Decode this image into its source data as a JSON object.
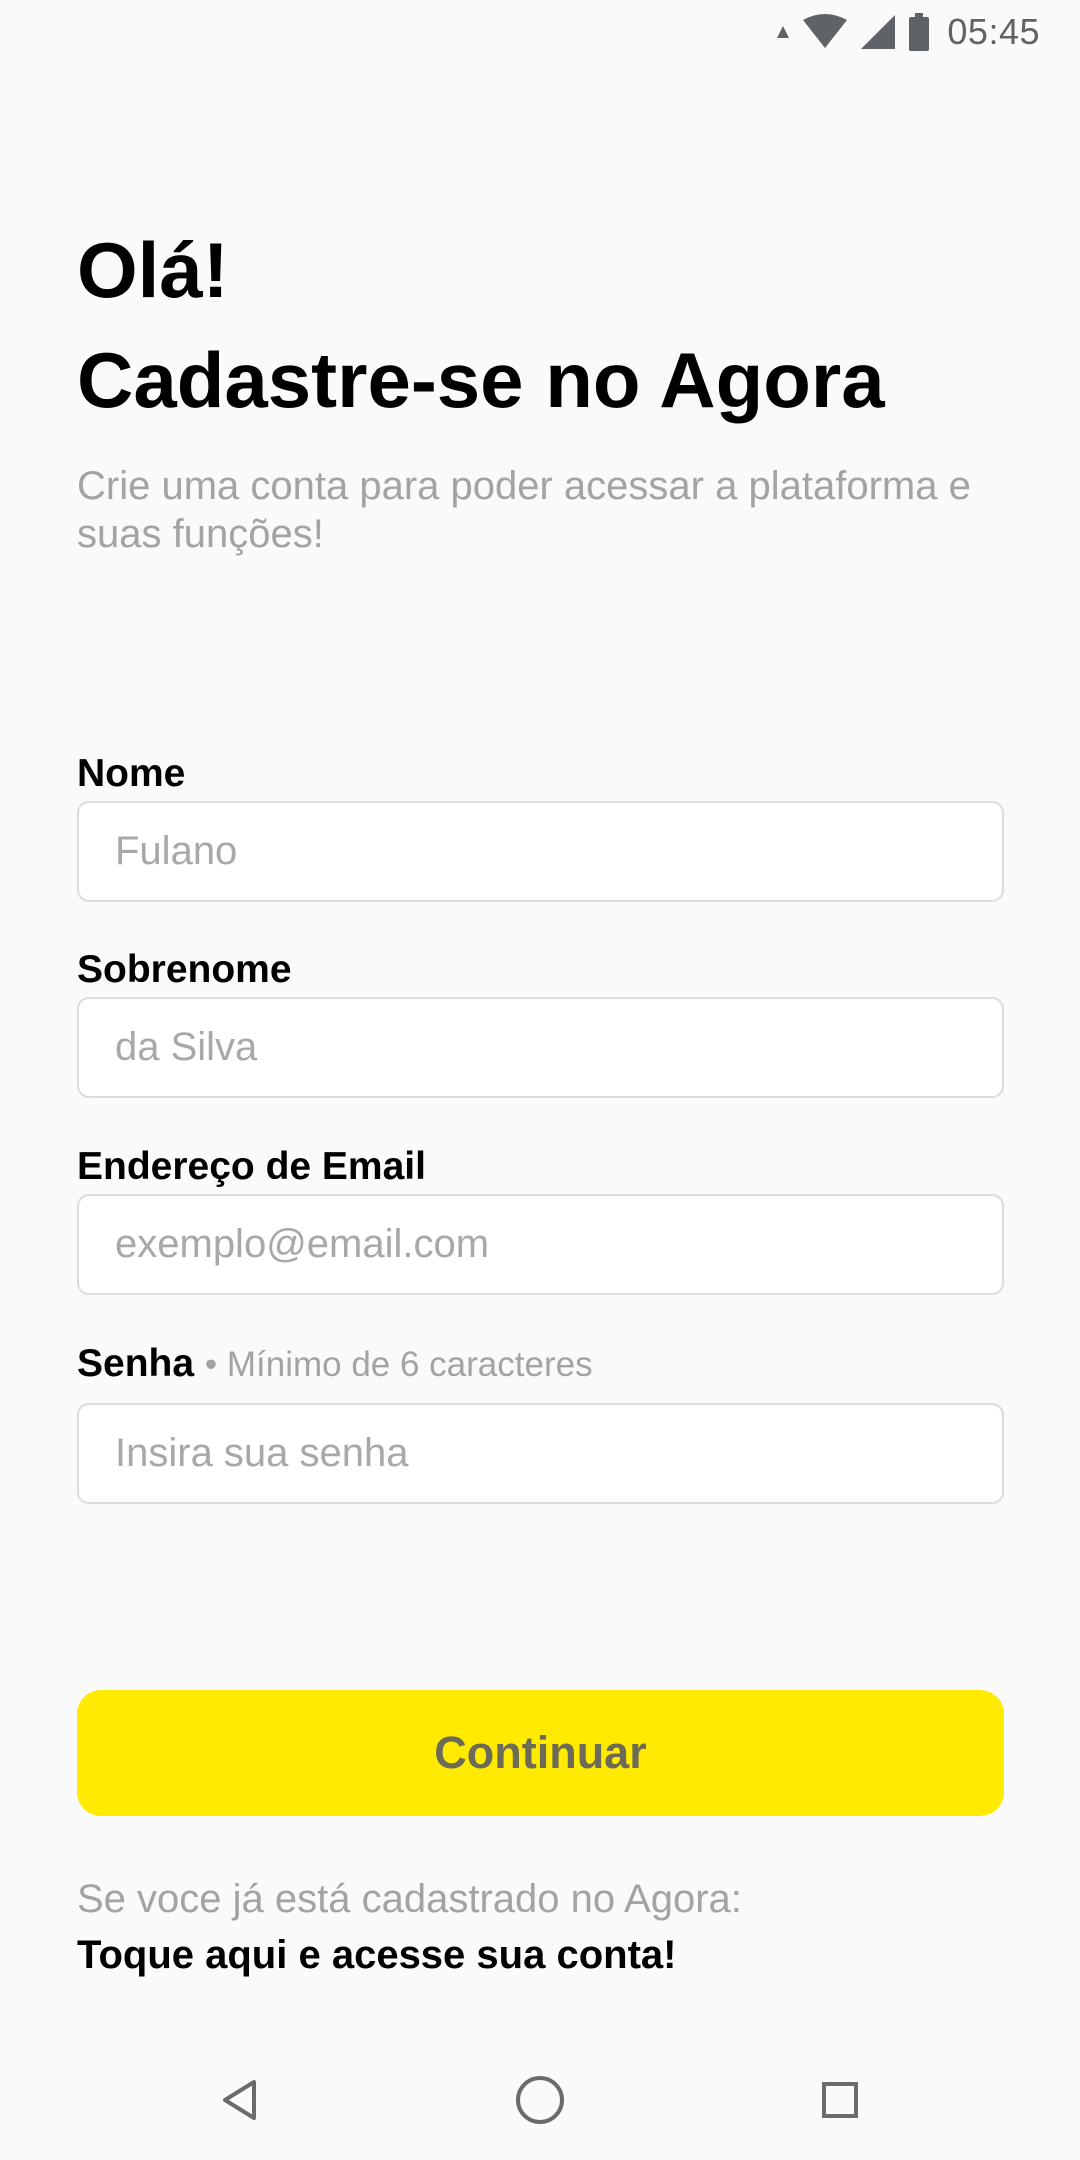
{
  "status_bar": {
    "time": "05:45",
    "icons": [
      "data-arrow-icon",
      "wifi-icon",
      "signal-icon",
      "battery-icon"
    ]
  },
  "header": {
    "greeting": "Olá!",
    "title": "Cadastre-se no Agora",
    "subtitle": "Crie uma conta para poder acessar a plataforma e suas funções!"
  },
  "form": {
    "first_name": {
      "label": "Nome",
      "placeholder": "Fulano",
      "value": ""
    },
    "last_name": {
      "label": "Sobrenome",
      "placeholder": "da Silva",
      "value": ""
    },
    "email": {
      "label": "Endereço de Email",
      "placeholder": "exemplo@email.com",
      "value": ""
    },
    "password": {
      "label": "Senha",
      "hint": "• Mínimo de 6 caracteres",
      "placeholder": "Insira sua senha",
      "value": ""
    }
  },
  "actions": {
    "continue_label": "Continuar",
    "login_prompt": "Se voce já está cadastrado no Agora:",
    "login_link": "Toque aqui e acesse sua conta!"
  },
  "nav_bar": {
    "icons": [
      "back-triangle-icon",
      "home-circle-icon",
      "recents-square-icon"
    ]
  },
  "colors": {
    "background": "#fafafa",
    "accent": "#ffea00",
    "muted_text": "#a3a3a3"
  }
}
